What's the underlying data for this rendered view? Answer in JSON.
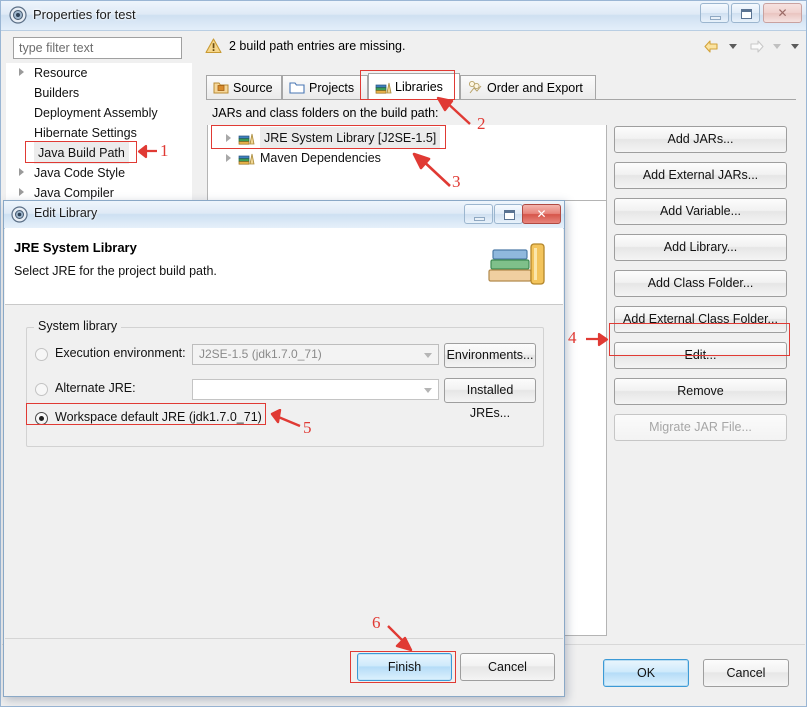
{
  "window": {
    "title": "Properties for test",
    "icon": "eclipse-properties-icon",
    "controls": {
      "minimize": "minimize-button",
      "maximize": "maximize-button",
      "close": "close-button"
    }
  },
  "filter": {
    "placeholder": "type filter text",
    "value": ""
  },
  "sidebar": {
    "items": [
      {
        "label": "Resource",
        "expandable": true,
        "selected": false
      },
      {
        "label": "Builders",
        "expandable": false,
        "selected": false
      },
      {
        "label": "Deployment Assembly",
        "expandable": false,
        "selected": false
      },
      {
        "label": "Hibernate Settings",
        "expandable": false,
        "selected": false
      },
      {
        "label": "Java Build Path",
        "expandable": false,
        "selected": true
      },
      {
        "label": "Java Code Style",
        "expandable": true,
        "selected": false
      },
      {
        "label": "Java Compiler",
        "expandable": true,
        "selected": false
      }
    ]
  },
  "warning": {
    "icon": "warning-triangle-icon",
    "text": "2 build path entries are missing."
  },
  "nav": {
    "back": "back-arrow-icon",
    "forward": "forward-arrow-icon",
    "menu": "dropdown-caret-icon"
  },
  "tabs": [
    {
      "label": "Source",
      "icon": "source-folder-icon",
      "active": false
    },
    {
      "label": "Projects",
      "icon": "projects-folder-icon",
      "active": false
    },
    {
      "label": "Libraries",
      "icon": "libraries-books-icon",
      "active": true
    },
    {
      "label": "Order and Export",
      "icon": "order-export-icon",
      "active": false
    }
  ],
  "libraries": {
    "caption": "JARs and class folders on the build path:",
    "rows": [
      {
        "label": "JRE System Library [J2SE-1.5]",
        "icon": "library-books-icon",
        "selected": true
      },
      {
        "label": "Maven Dependencies",
        "icon": "library-books-icon",
        "selected": false
      }
    ]
  },
  "side_buttons": [
    {
      "label": "Add JARs...",
      "disabled": false
    },
    {
      "label": "Add External JARs...",
      "disabled": false
    },
    {
      "label": "Add Variable...",
      "disabled": false
    },
    {
      "label": "Add Library...",
      "disabled": false
    },
    {
      "label": "Add Class Folder...",
      "disabled": false
    },
    {
      "label": "Add External Class Folder...",
      "disabled": false
    },
    {
      "label": "Edit...",
      "disabled": false
    },
    {
      "label": "Remove",
      "disabled": false
    },
    {
      "label": "Migrate JAR File...",
      "disabled": true
    }
  ],
  "footer": {
    "help_icon": "help-question-icon",
    "ok_label": "OK",
    "cancel_label": "Cancel"
  },
  "edit_dialog": {
    "title": "Edit Library",
    "icon": "eclipse-dialog-icon",
    "header_title": "JRE System Library",
    "header_subtitle": "Select JRE for the project build path.",
    "header_image": "books-stack-icon",
    "group_label": "System library",
    "options": [
      {
        "label": "Execution environment:",
        "selected": false,
        "enabled": false,
        "combo_value": "J2SE-1.5 (jdk1.7.0_71)",
        "button_label": "Environments..."
      },
      {
        "label": "Alternate JRE:",
        "selected": false,
        "enabled": false,
        "combo_value": "",
        "button_label": "Installed JREs..."
      },
      {
        "label": "Workspace default JRE (jdk1.7.0_71)",
        "selected": true,
        "enabled": true,
        "combo_value": "",
        "button_label": ""
      }
    ],
    "finish_label": "Finish",
    "cancel_label": "Cancel",
    "controls": {
      "minimize": "minimize-button",
      "maximize": "maximize-button",
      "close": "close-button"
    }
  },
  "annotations": [
    {
      "number": "1",
      "target": "sidebar-item-java-build-path"
    },
    {
      "number": "2",
      "target": "tab-libraries"
    },
    {
      "number": "3",
      "target": "library-row-jre-system-library"
    },
    {
      "number": "4",
      "target": "edit-button"
    },
    {
      "number": "5",
      "target": "workspace-default-jre-radio"
    },
    {
      "number": "6",
      "target": "finish-button"
    }
  ],
  "colors": {
    "annotation": "#e03a34",
    "accent": "#3c9ad6",
    "warning": "#e8a33d"
  }
}
